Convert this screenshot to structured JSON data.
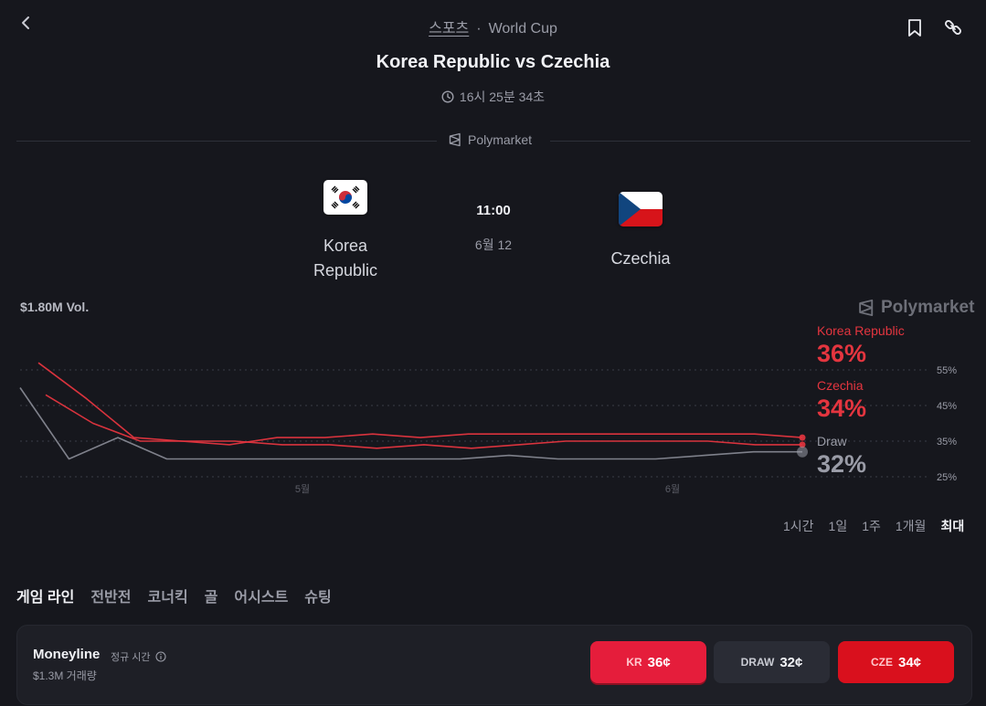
{
  "header": {
    "category": "스포츠",
    "separator": "·",
    "competition": "World Cup",
    "title": "Korea Republic vs Czechia",
    "countdown": "16시 25분 34초"
  },
  "source": {
    "name": "Polymarket"
  },
  "match": {
    "home": {
      "name_line1": "Korea",
      "name_line2": "Republic"
    },
    "away": {
      "name": "Czechia"
    },
    "kickoff_time": "11:00",
    "kickoff_date": "6월 12"
  },
  "chart": {
    "volume": "$1.80M Vol.",
    "legend": [
      {
        "name": "Korea Republic",
        "value": "36%",
        "color": "#e4353f"
      },
      {
        "name": "Czechia",
        "value": "34%",
        "color": "#e4353f"
      },
      {
        "name": "Draw",
        "value": "32%",
        "color": "#9a9ca7"
      }
    ],
    "ranges": [
      "1시간",
      "1일",
      "1주",
      "1개월",
      "최대"
    ],
    "active_range": "최대"
  },
  "chart_data": {
    "type": "line",
    "y_ticks": [
      "55%",
      "45%",
      "35%",
      "25%"
    ],
    "x_ticks": [
      "5월",
      "6월"
    ],
    "ylim": [
      25,
      55
    ],
    "grid": true,
    "series": [
      {
        "name": "Korea Republic",
        "color": "#e4353f",
        "values": [
          57,
          47,
          36,
          35,
          34,
          36,
          36,
          37,
          36,
          37,
          37,
          37,
          37,
          37,
          37,
          37,
          36
        ]
      },
      {
        "name": "Czechia",
        "color": "#e4353f",
        "values": [
          48,
          40,
          35,
          35,
          35,
          34,
          34,
          33,
          34,
          33,
          34,
          35,
          35,
          35,
          35,
          34,
          34
        ]
      },
      {
        "name": "Draw",
        "color": "#9a9ca7",
        "values": [
          50,
          30,
          36,
          30,
          30,
          30,
          30,
          30,
          30,
          30,
          31,
          30,
          30,
          30,
          31,
          32,
          32
        ]
      }
    ]
  },
  "tabs": [
    "게임 라인",
    "전반전",
    "코너킥",
    "골",
    "어시스트",
    "슈팅"
  ],
  "active_tab": "게임 라인",
  "moneyline": {
    "title": "Moneyline",
    "subtitle": "정규 시간",
    "volume": "$1.3M 거래량",
    "outcomes": [
      {
        "label": "KR",
        "price": "36¢"
      },
      {
        "label": "DRAW",
        "price": "32¢"
      },
      {
        "label": "CZE",
        "price": "34¢"
      }
    ]
  },
  "icons": [
    "chevron-left-icon",
    "bookmark-icon",
    "link-icon",
    "clock-icon",
    "polymarket-logo-icon",
    "info-icon"
  ]
}
